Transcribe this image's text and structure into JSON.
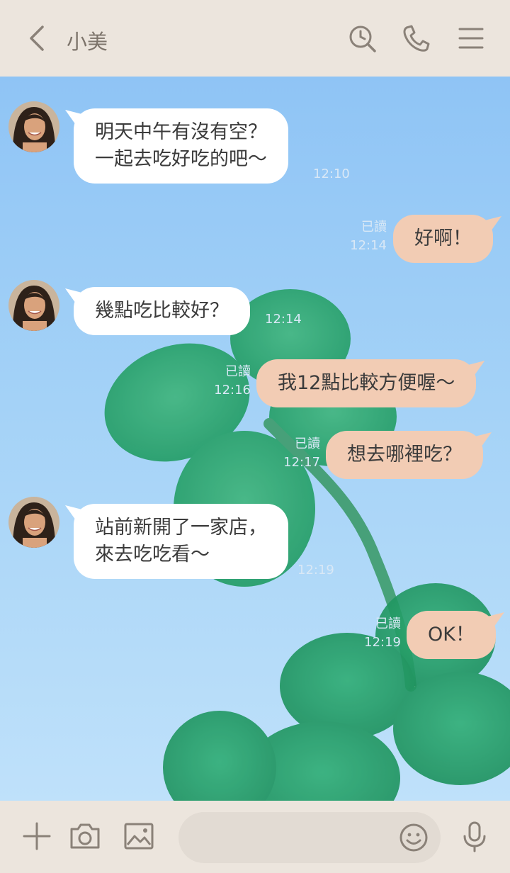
{
  "header": {
    "title": "小美"
  },
  "messages": [
    {
      "side": "in",
      "lines": [
        "明天中午有沒有空？",
        "一起去吃好吃的吧～"
      ],
      "time": "12:10"
    },
    {
      "side": "out",
      "lines": [
        "好啊！"
      ],
      "time": "12:14",
      "read": "已讀"
    },
    {
      "side": "in",
      "lines": [
        "幾點吃比較好？"
      ],
      "time": "12:14"
    },
    {
      "side": "out",
      "lines": [
        "我12點比較方便喔～"
      ],
      "time": "12:16",
      "read": "已讀"
    },
    {
      "side": "out",
      "lines": [
        "想去哪裡吃？"
      ],
      "time": "12:17",
      "read": "已讀"
    },
    {
      "side": "in",
      "lines": [
        "站前新開了一家店，",
        "來去吃吃看～"
      ],
      "time": "12:19"
    },
    {
      "side": "out",
      "lines": [
        "OK！"
      ],
      "time": "12:19",
      "read": "已讀"
    }
  ],
  "icons": {
    "back": "chevron-left-icon",
    "search": "search-clock-icon",
    "call": "phone-icon",
    "menu": "hamburger-menu-icon",
    "plus": "plus-icon",
    "camera": "camera-icon",
    "image": "image-icon",
    "emoji": "smiley-icon",
    "mic": "microphone-icon"
  },
  "colors": {
    "header_bg": "#ece5dd",
    "outgoing_bubble": "#f2ccb4",
    "incoming_bubble": "#ffffff",
    "icon": "#8a8178"
  }
}
